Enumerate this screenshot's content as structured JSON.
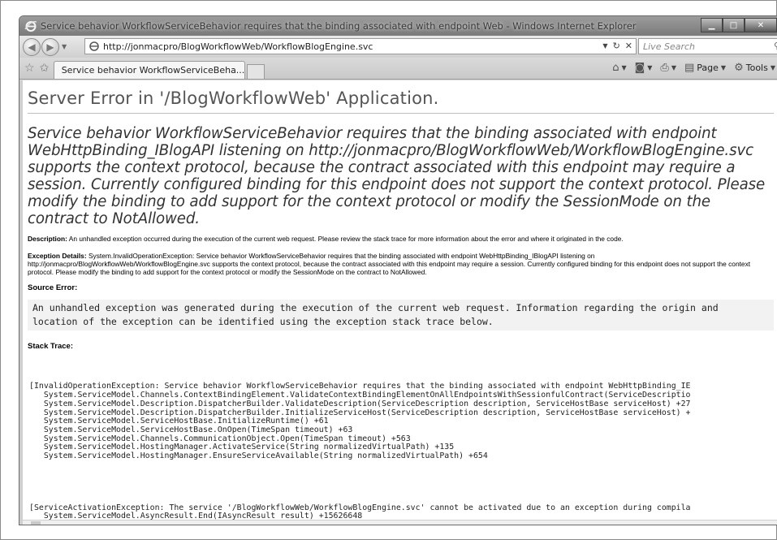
{
  "window": {
    "title": "Service behavior WorkflowServiceBehavior requires that the binding associated with endpoint Web - Windows Internet Explorer",
    "controls": [
      "minimize",
      "maximize",
      "close"
    ]
  },
  "address": {
    "url": "http://jonmacpro/BlogWorkflowWeb/WorkflowBlogEngine.svc",
    "search_placeholder": "Live Search"
  },
  "tab": {
    "label": "Service behavior WorkflowServiceBeha..."
  },
  "command_bar": {
    "page_label": "Page",
    "tools_label": "Tools"
  },
  "page": {
    "heading": "Server Error in '/BlogWorkflowWeb' Application.",
    "error_message": "Service behavior WorkflowServiceBehavior requires that the binding associated with endpoint WebHttpBinding_IBlogAPI listening on http://jonmacpro/BlogWorkflowWeb/WorkflowBlogEngine.svc supports the context protocol, because the contract associated with this endpoint may require a session. Currently configured binding for this endpoint does not support the context protocol. Please modify the binding to add support for the context protocol or modify the SessionMode on the contract to NotAllowed.",
    "description_label": "Description:",
    "description_text": "An unhandled exception occurred during the execution of the current web request. Please review the stack trace for more information about the error and where it originated in the code.",
    "exception_label": "Exception Details:",
    "exception_text": "System.InvalidOperationException: Service behavior WorkflowServiceBehavior requires that the binding associated with endpoint WebHttpBinding_IBlogAPI listening on http://jonmacpro/BlogWorkflowWeb/WorkflowBlogEngine.svc supports the context protocol, because the contract associated with this endpoint may require a session. Currently configured binding for this endpoint does not support the context protocol. Please modify the binding to add support for the context protocol or modify the SessionMode on the contract to NotAllowed.",
    "source_error_label": "Source Error:",
    "source_error_text": "An unhandled exception was generated during the execution of the current web request. Information regarding the origin and\nlocation of the exception can be identified using the exception stack trace below.",
    "stack_trace_label": "Stack Trace:",
    "stack_trace_1": "[InvalidOperationException: Service behavior WorkflowServiceBehavior requires that the binding associated with endpoint WebHttpBinding_IE\n   System.ServiceModel.Channels.ContextBindingElement.ValidateContextBindingElementOnAllEndpointsWithSessionfulContract(ServiceDescriptio\n   System.ServiceModel.Description.DispatcherBuilder.ValidateDescription(ServiceDescription description, ServiceHostBase serviceHost) +27\n   System.ServiceModel.Description.DispatcherBuilder.InitializeServiceHost(ServiceDescription description, ServiceHostBase serviceHost) +\n   System.ServiceModel.ServiceHostBase.InitializeRuntime() +61\n   System.ServiceModel.ServiceHostBase.OnOpen(TimeSpan timeout) +63\n   System.ServiceModel.Channels.CommunicationObject.Open(TimeSpan timeout) +563\n   System.ServiceModel.HostingManager.ActivateService(String normalizedVirtualPath) +135\n   System.ServiceModel.HostingManager.EnsureServiceAvailable(String normalizedVirtualPath) +654",
    "stack_trace_2": "[ServiceActivationException: The service '/BlogWorkflowWeb/WorkflowBlogEngine.svc' cannot be activated due to an exception during compila\n   System.ServiceModel.AsyncResult.End(IAsyncResult result) +15626648"
  }
}
